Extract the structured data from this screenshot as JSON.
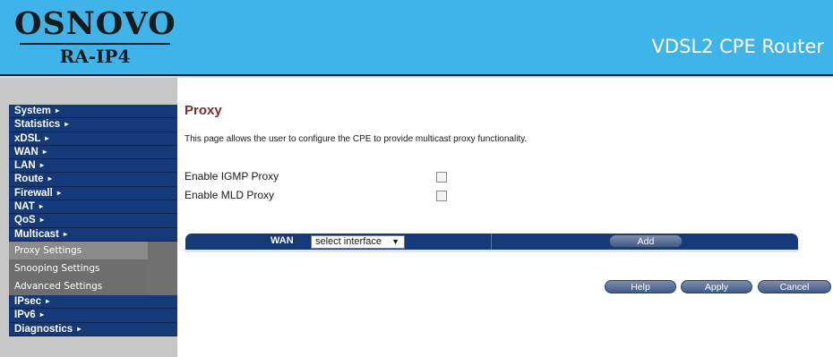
{
  "header": {
    "logo": "OSNOVO",
    "model": "RA-IP4",
    "title": "VDSL2 CPE Router"
  },
  "sidebar": {
    "items": [
      {
        "label": "System"
      },
      {
        "label": "Statistics"
      },
      {
        "label": "xDSL"
      },
      {
        "label": "WAN"
      },
      {
        "label": "LAN"
      },
      {
        "label": "Route"
      },
      {
        "label": "Firewall"
      },
      {
        "label": "NAT"
      },
      {
        "label": "QoS"
      },
      {
        "label": "Multicast"
      }
    ],
    "submenu": [
      {
        "label": "Proxy Settings",
        "active": true
      },
      {
        "label": "Snooping Settings"
      },
      {
        "label": "Advanced Settings"
      }
    ],
    "items_after": [
      {
        "label": "IPsec"
      },
      {
        "label": "IPv6"
      },
      {
        "label": "Diagnostics"
      }
    ],
    "arrow": "▸"
  },
  "main": {
    "title": "Proxy",
    "description": "This page allows the user to configure the CPE to provide multicast proxy functionality.",
    "options": [
      {
        "label": "Enable IGMP Proxy",
        "checked": false
      },
      {
        "label": "Enable MLD Proxy",
        "checked": false
      }
    ],
    "wan": {
      "label": "WAN",
      "select_value": "select interface",
      "add_label": "Add"
    },
    "buttons": {
      "help": "Help",
      "apply": "Apply",
      "cancel": "Cancel"
    }
  },
  "colors": {
    "header_bg": "#3fb4e8",
    "nav_bg": "#163a78",
    "title_color": "#7b3030"
  }
}
